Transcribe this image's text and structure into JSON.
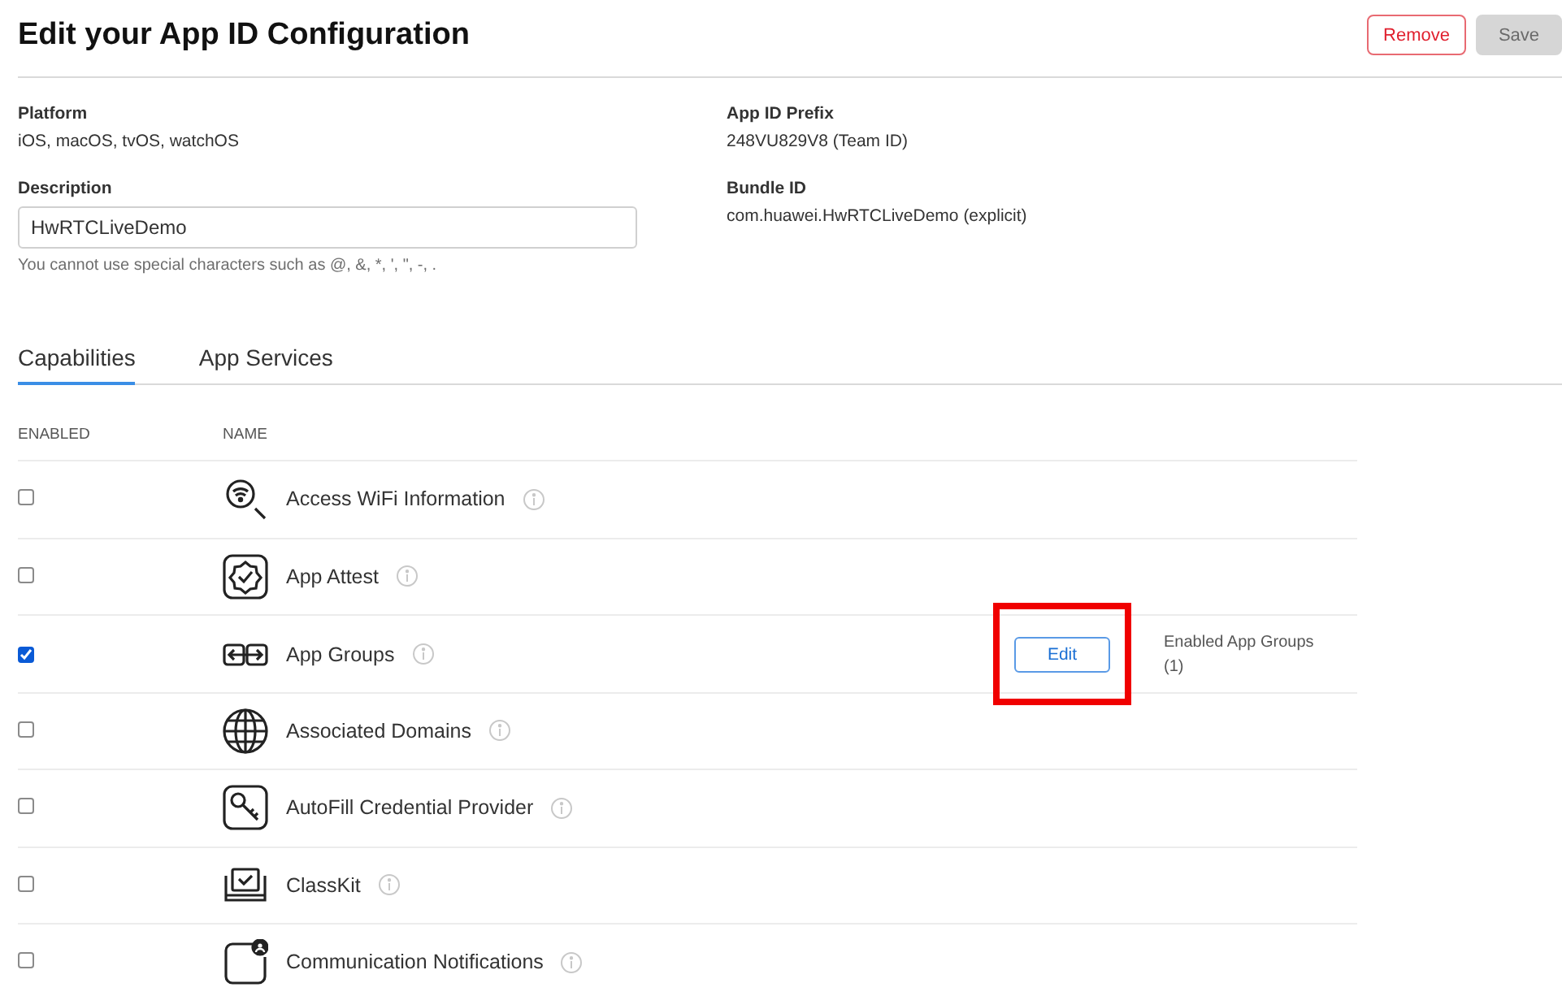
{
  "page": {
    "title": "Edit your App ID Configuration",
    "buttons": [
      {
        "label": "Remove",
        "kind": "destructive",
        "disabled": false
      },
      {
        "label": "Save",
        "kind": "primary",
        "disabled": true
      }
    ]
  },
  "details": {
    "platform": {
      "label": "Platform",
      "value": "iOS, macOS, tvOS, watchOS"
    },
    "description": {
      "label": "Description",
      "value": "HwRTCLiveDemo",
      "hint": "You cannot use special characters such as @, &, *, ', \", -, ."
    },
    "prefix": {
      "label": "App ID Prefix",
      "value": "248VU829V8 (Team ID)"
    },
    "bundle": {
      "label": "Bundle ID",
      "value": "com.huawei.HwRTCLiveDemo (explicit)"
    }
  },
  "tabs": [
    {
      "label": "Capabilities",
      "selected": true
    },
    {
      "label": "App Services",
      "selected": false
    }
  ],
  "table": {
    "columns": [
      "ENABLED",
      "NAME"
    ],
    "rows": [
      {
        "name": "Access WiFi Information",
        "checked": false
      },
      {
        "name": "App Attest",
        "checked": false
      },
      {
        "name": "App Groups",
        "checked": true,
        "action": {
          "label": "Edit",
          "highlighted": true
        },
        "note": "Enabled App Groups (1)"
      },
      {
        "name": "Associated Domains",
        "checked": false
      },
      {
        "name": "AutoFill Credential Provider",
        "checked": false
      },
      {
        "name": "ClassKit",
        "checked": false
      },
      {
        "name": "Communication Notifications",
        "checked": false
      }
    ]
  }
}
